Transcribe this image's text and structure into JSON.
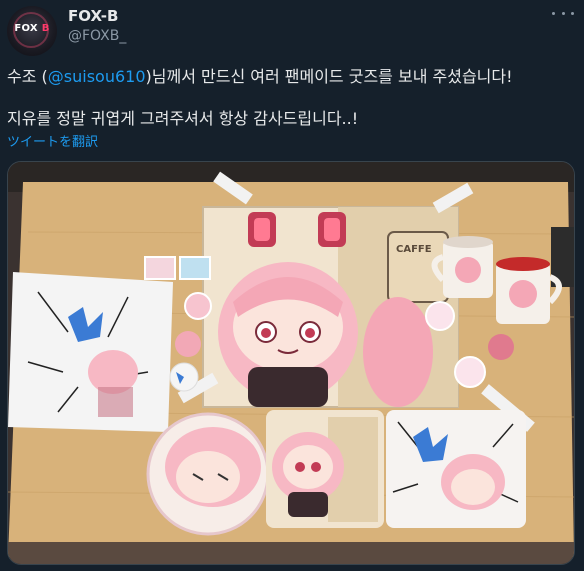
{
  "author": {
    "avatar_text_main": "FOX",
    "avatar_text_accent": "B",
    "display_name": "FOX-B",
    "handle": "@FOXB_"
  },
  "tweet": {
    "text_before_mention": "수조 (",
    "mention": "@suisou610",
    "text_after_mention": ")님께서 만드신 여러 팬메이드 굿즈를 보내 주셨습니다!",
    "line2": "지유를 정말 귀엽게 그려주셔서 항상 감사드립니다..!",
    "translate_label": "ツイートを翻訳"
  },
  "media": {
    "cup_label": "CAFFE"
  },
  "colors": {
    "background": "#15202b",
    "text_primary": "#e7e9ea",
    "text_secondary": "#8b98a5",
    "link": "#1d9bf0"
  },
  "icons": {
    "more": "more-horizontal-icon"
  }
}
